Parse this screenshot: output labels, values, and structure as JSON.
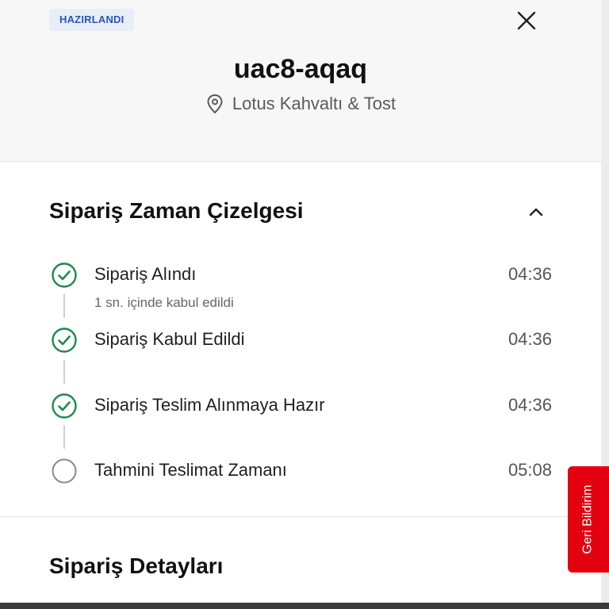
{
  "header": {
    "status_badge": "HAZIRLANDI",
    "order_code": "uac8-aqaq",
    "store_name": "Lotus Kahvaltı & Tost",
    "close_icon": "close-icon",
    "location_icon": "location-pin-icon"
  },
  "timeline_section": {
    "title": "Sipariş Zaman Çizelgesi",
    "collapse_icon": "chevron-up-icon",
    "steps": [
      {
        "label": "Sipariş Alındı",
        "time": "04:36",
        "subtext": "1 sn. içinde kabul edildi",
        "status": "completed"
      },
      {
        "label": "Sipariş Kabul Edildi",
        "time": "04:36",
        "status": "completed"
      },
      {
        "label": "Sipariş Teslim Alınmaya Hazır",
        "time": "04:36",
        "status": "completed"
      },
      {
        "label": "Tahmini Teslimat Zamanı",
        "time": "05:08",
        "status": "pending"
      }
    ]
  },
  "details_section": {
    "title": "Sipariş Detayları"
  },
  "feedback": {
    "label": "Geri Bildirim"
  },
  "colors": {
    "completed_check": "#1e8a4c",
    "pending_circle": "#8a8a8a",
    "badge_bg": "#e7eef8",
    "badge_text": "#2855b8",
    "feedback_bg": "#e3000f"
  }
}
